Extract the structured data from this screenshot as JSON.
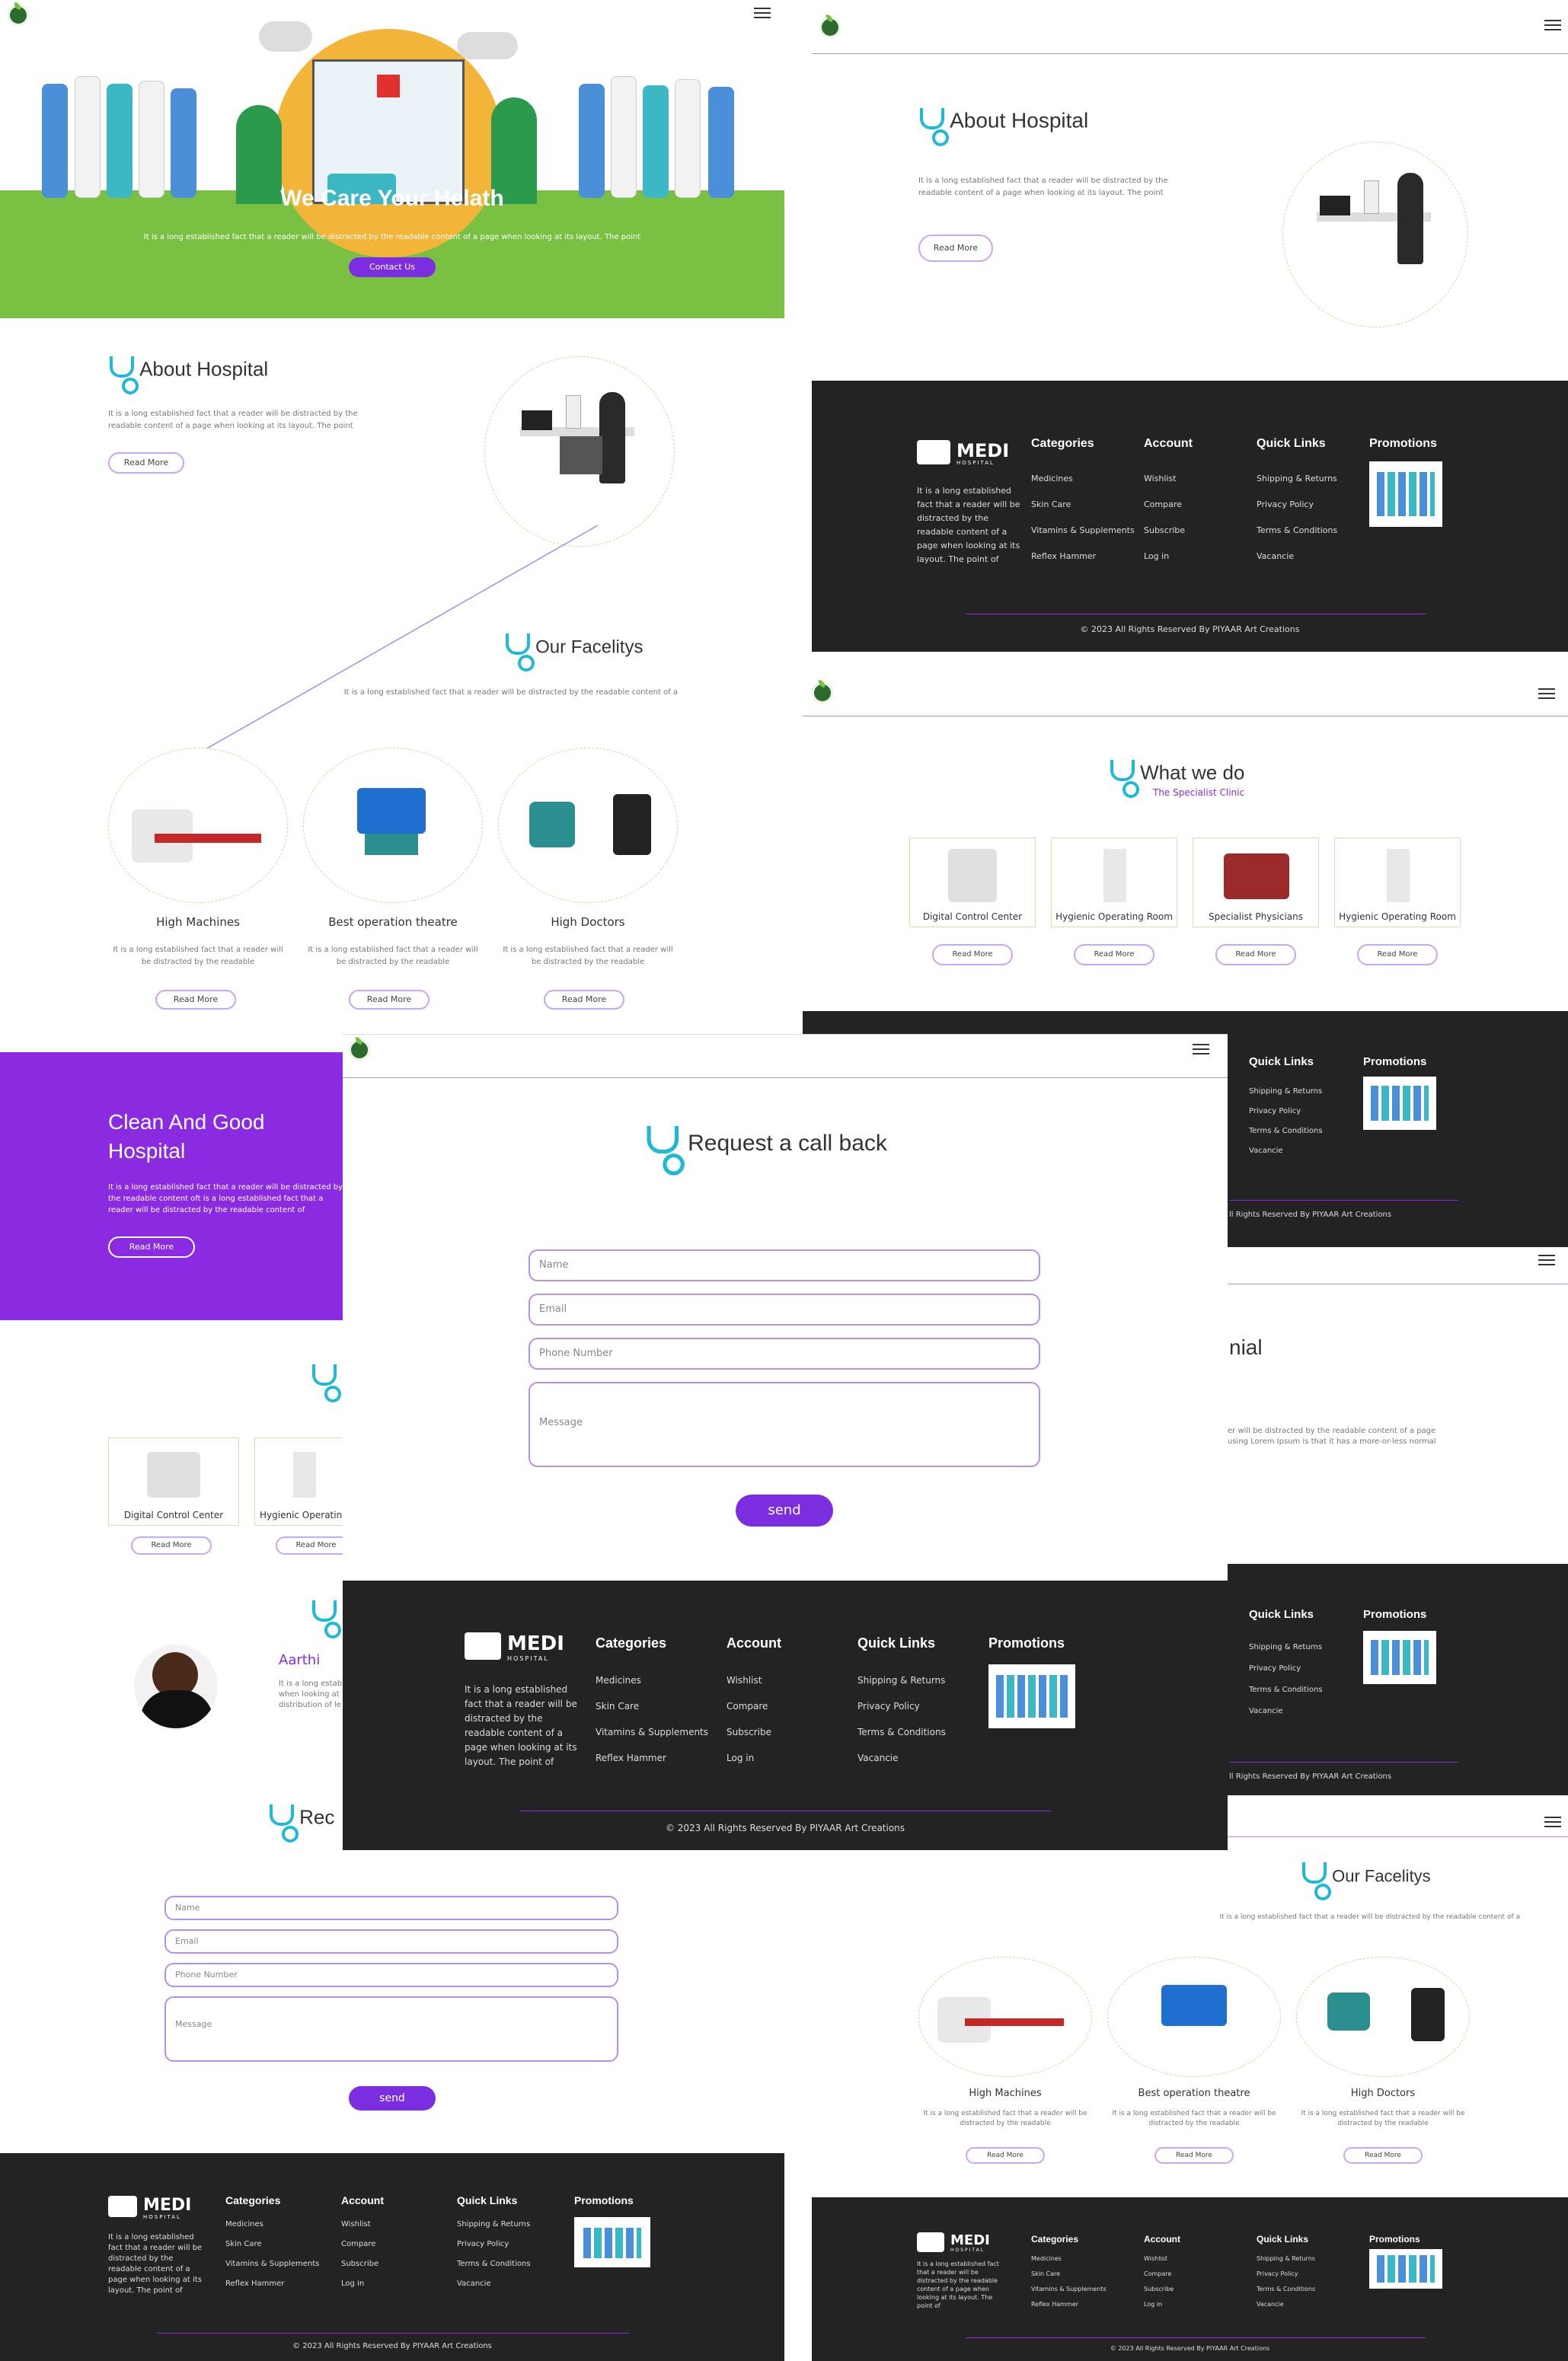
{
  "brand": {
    "name": "MEDI",
    "sub": "HOSPITAL"
  },
  "hero": {
    "title": "We Care Your Helath",
    "text": "It is a long established fact that a reader will be distracted by the readable content of a page when looking at its layout. The point",
    "cta": "Contact Us"
  },
  "about": {
    "title": "About Hospital",
    "text": "It is a long established fact that a reader will be distracted by the readable content of a page when looking at its layout. The point",
    "button": "Read More"
  },
  "facilities": {
    "title": "Our Facelitys",
    "text": "It is a long established fact that a reader will be distracted by the readable content of a",
    "items": [
      {
        "name": "High Machines",
        "text": "It is a long established fact that a reader will be distracted by the readable",
        "button": "Read More"
      },
      {
        "name": "Best operation theatre",
        "text": "It is a long established fact that a reader will be distracted by the readable",
        "button": "Read More"
      },
      {
        "name": "High Doctors",
        "text": "It is a long established fact that a reader will be distracted by the readable",
        "button": "Read More"
      }
    ]
  },
  "clean": {
    "title1": "Clean And Good",
    "title2": "Hospital",
    "text": "It is a long established fact that a reader will be distracted by the readable content oft is a long established fact that a reader will be distracted by the readable content of",
    "button": "Read More"
  },
  "whatwedo": {
    "title": "What we do",
    "subtitle": "The Specialist Clinic",
    "items": [
      {
        "name": "Digital Control Center",
        "button": "Read More"
      },
      {
        "name": "Hygienic Operating Room",
        "button": "Read More"
      },
      {
        "name": "Specialist Physicians",
        "button": "Read More"
      },
      {
        "name": "Hygienic Operating Room",
        "button": "Read More"
      }
    ]
  },
  "testimonial": {
    "title_fragment": "nial",
    "name": "Aarthi",
    "text1": "er will be distracted by the readable content of a page",
    "text2": "using Lorem Ipsum is that it has a more-or-less normal",
    "left_text1": "It is a long establi",
    "left_text2": "when looking at",
    "left_text3": "distribution of le"
  },
  "callback": {
    "title": "Request a call back",
    "title_fragment": "Rec",
    "name_ph": "Name",
    "email_ph": "Email",
    "phone_ph": "Phone Number",
    "message_ph": "Message",
    "send": "send"
  },
  "footer": {
    "desc": "It is a long established fact that a reader will be distracted by the readable content of a page when looking at its layout. The point of",
    "categories": {
      "title": "Categories",
      "items": [
        "Medicines",
        "Skin Care",
        "Vitamins & Supplements",
        "Reflex Hammer"
      ]
    },
    "account": {
      "title": "Account",
      "items": [
        "Wishlist",
        "Compare",
        "Subscribe",
        "Log in"
      ]
    },
    "quick": {
      "title": "Quick Links",
      "items": [
        "Shipping & Returns",
        "Privacy Policy",
        "Terms & Conditions",
        "Vacancie"
      ]
    },
    "promotions": {
      "title": "Promotions"
    },
    "copyright": "© 2023 All Rights Reserved By PIYAAR Art Creations",
    "copyright_fragment": "ll Rights Reserved By PIYAAR Art Creations",
    "copyright_fragment2": "ll Rights Reserved By PIYAAR Art Creations"
  },
  "colors": {
    "purple": "#7b2ee0",
    "green": "#7ac143",
    "dark": "#232323",
    "teal": "#1fb9d8"
  }
}
